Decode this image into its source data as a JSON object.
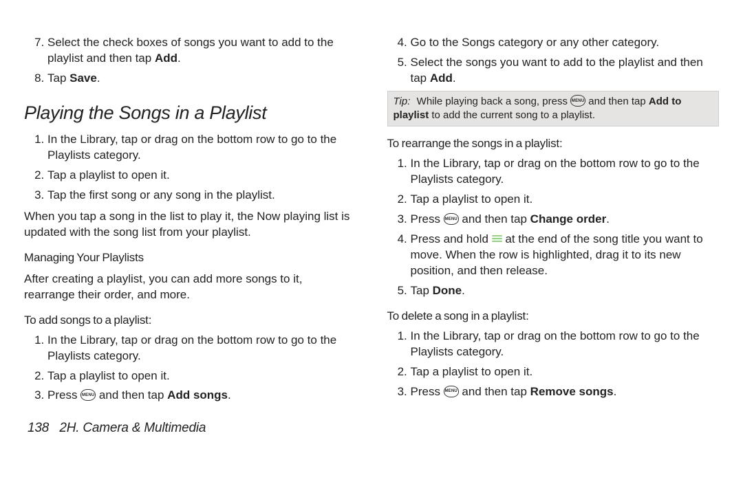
{
  "col1": {
    "step7_pre": "Select the check boxes of songs you want to add to the playlist and then tap ",
    "step7_bold": "Add",
    "step7_post": ".",
    "step8_pre": "Tap ",
    "step8_bold": "Save",
    "step8_post": ".",
    "h2": "Playing the Songs in a Playlist",
    "p1": "In the Library, tap or drag on the bottom row to go to the Playlists category.",
    "p2": "Tap a playlist to open it.",
    "p3": "Tap the first song or any song in the playlist.",
    "para1": "When you tap a song in the list to play it, the Now playing list is updated with the song list from your playlist.",
    "manage_head": "Managing Your Playlists",
    "manage_para": "After creating a playlist, you can add more songs to it, rearrange their order, and more.",
    "add_head": "To add songs to a playlist:",
    "a1": "In the Library, tap or drag on the bottom row to go to the Playlists category.",
    "a2": "Tap a playlist to open it.",
    "a3_pre": "Press ",
    "a3_mid": " and then tap ",
    "a3_bold": "Add songs",
    "a3_post": "."
  },
  "col2": {
    "s4": "Go to the Songs category or any other category.",
    "s5_pre": "Select the songs you want to add to the playlist and then tap ",
    "s5_bold": "Add",
    "s5_post": ".",
    "tip_label": "Tip:",
    "tip_pre": "While playing back a song, press ",
    "tip_mid": " and then tap ",
    "tip_bold": "Add to playlist",
    "tip_post": " to add the current song to a playlist.",
    "re_head": "To rearrange the songs in a playlist:",
    "r1": "In the Library, tap or drag on the bottom row to go to the Playlists category.",
    "r2": "Tap a playlist to open it.",
    "r3_pre": "Press ",
    "r3_mid": " and then tap ",
    "r3_bold": "Change order",
    "r3_post": ".",
    "r4_pre": "Press and hold ",
    "r4_post": " at the end of the song title you want to move. When the row is highlighted, drag it to its new position, and then release.",
    "r5_pre": "Tap ",
    "r5_bold": "Done",
    "r5_post": ".",
    "del_head": "To delete a song in a playlist:",
    "d1": "In the Library, tap or drag on the bottom row to go to the Playlists category.",
    "d2": "Tap a playlist to open it.",
    "d3_pre": "Press ",
    "d3_mid": " and then tap ",
    "d3_bold": "Remove songs",
    "d3_post": "."
  },
  "footer": {
    "page": "138",
    "section": "2H. Camera & Multimedia"
  },
  "icons": {
    "menu": "MENU"
  }
}
